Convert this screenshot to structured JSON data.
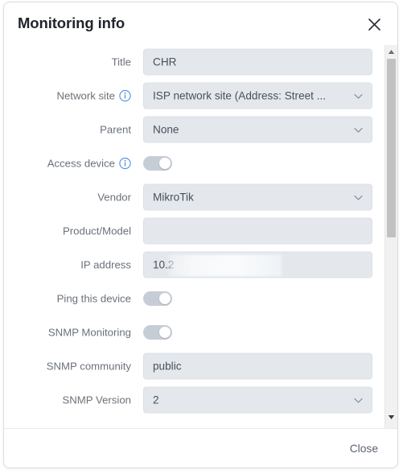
{
  "dialog": {
    "title": "Monitoring info",
    "close_icon": "close-icon"
  },
  "form": {
    "rows": [
      {
        "label": "Title",
        "info": false,
        "control": "text",
        "value": "CHR",
        "placeholder": "",
        "redacted": false
      },
      {
        "label": "Network site",
        "info": true,
        "control": "select",
        "value": "ISP network site (Address: Street ...",
        "placeholder": "",
        "redacted": false
      },
      {
        "label": "Parent",
        "info": false,
        "control": "select",
        "value": "None",
        "placeholder": "",
        "redacted": false
      },
      {
        "label": "Access device",
        "info": true,
        "control": "toggle",
        "value": "on",
        "placeholder": "",
        "redacted": false
      },
      {
        "label": "Vendor",
        "info": false,
        "control": "select",
        "value": "MikroTik",
        "placeholder": "",
        "redacted": false
      },
      {
        "label": "Product/Model",
        "info": false,
        "control": "text",
        "value": "",
        "placeholder": "",
        "redacted": false
      },
      {
        "label": "IP address",
        "info": false,
        "control": "text",
        "value": "10.2",
        "placeholder": "",
        "redacted": true
      },
      {
        "label": "Ping this device",
        "info": false,
        "control": "toggle",
        "value": "on",
        "placeholder": "",
        "redacted": false
      },
      {
        "label": "SNMP Monitoring",
        "info": false,
        "control": "toggle",
        "value": "on",
        "placeholder": "",
        "redacted": false
      },
      {
        "label": "SNMP community",
        "info": false,
        "control": "text",
        "value": "public",
        "placeholder": "",
        "redacted": false
      },
      {
        "label": "SNMP Version",
        "info": false,
        "control": "select",
        "value": "2",
        "placeholder": "",
        "redacted": false
      }
    ]
  },
  "scrollbar": {
    "up_icon": "scroll-up-arrow-icon",
    "down_icon": "scroll-down-arrow-icon"
  },
  "footer": {
    "close_label": "Close"
  },
  "colors": {
    "field_bg": "#e4e8ed",
    "label_text": "#6b7179",
    "value_text": "#4a5058",
    "title_text": "#20242b",
    "info_blue": "#4a90e2",
    "toggle_track": "#c6cdd6",
    "scroll_thumb": "#c1c1c1",
    "footer_link": "#5c6470"
  }
}
